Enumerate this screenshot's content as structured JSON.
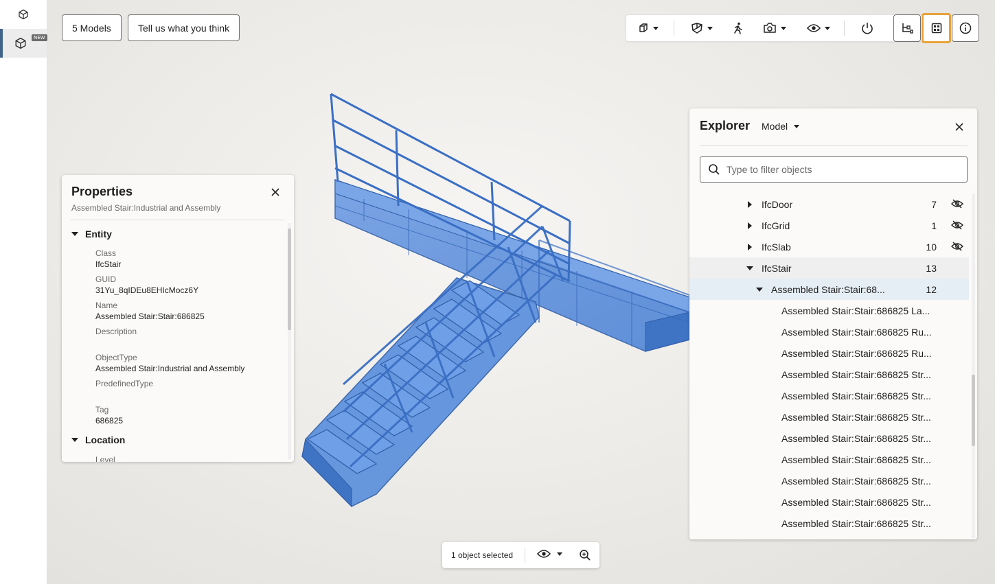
{
  "left_rail": {
    "items": [
      {
        "icon": "cube-icon",
        "active": false
      },
      {
        "icon": "cube-icon",
        "active": true,
        "badge": "NEW"
      }
    ]
  },
  "top_buttons": {
    "models_label": "5 Models",
    "feedback_label": "Tell us what you think"
  },
  "toolbar": {
    "icons": [
      "cube-view-icon",
      "section-box-icon",
      "walk-icon",
      "camera-icon",
      "eye-icon",
      "reset-icon",
      "tree-icon",
      "grid-icon",
      "info-icon"
    ],
    "active_button": "grid-icon",
    "active_color": "#e8a33a"
  },
  "properties": {
    "title": "Properties",
    "subtitle": "Assembled Stair:Industrial and Assembly",
    "sections": [
      {
        "title": "Entity",
        "fields": [
          {
            "label": "Class",
            "value": "IfcStair"
          },
          {
            "label": "GUID",
            "value": "31Yu_8qIDEu8EHIcMocz6Y"
          },
          {
            "label": "Name",
            "value": "Assembled Stair:Stair:686825"
          },
          {
            "label": "Description",
            "value": ""
          },
          {
            "label": "ObjectType",
            "value": "Assembled Stair:Industrial and Assembly"
          },
          {
            "label": "PredefinedType",
            "value": ""
          },
          {
            "label": "Tag",
            "value": "686825"
          }
        ]
      },
      {
        "title": "Location",
        "fields": [
          {
            "label": "Level",
            "value": ""
          }
        ]
      }
    ]
  },
  "explorer": {
    "title": "Explorer",
    "mode": "Model",
    "search_placeholder": "Type to filter objects",
    "rows": [
      {
        "label": "IfcDoor",
        "count": "7",
        "hidden": true,
        "expanded": false
      },
      {
        "label": "IfcGrid",
        "count": "1",
        "hidden": true,
        "expanded": false
      },
      {
        "label": "IfcSlab",
        "count": "10",
        "hidden": true,
        "expanded": false
      },
      {
        "label": "IfcStair",
        "count": "13",
        "hidden": false,
        "expanded": true
      },
      {
        "label": "Assembled Stair:Stair:68...",
        "count": "12",
        "hidden": false,
        "expanded": true,
        "selected": true
      },
      {
        "label": "Assembled Stair:Stair:686825 La..."
      },
      {
        "label": "Assembled Stair:Stair:686825 Ru..."
      },
      {
        "label": "Assembled Stair:Stair:686825 Ru..."
      },
      {
        "label": "Assembled Stair:Stair:686825 Str..."
      },
      {
        "label": "Assembled Stair:Stair:686825 Str..."
      },
      {
        "label": "Assembled Stair:Stair:686825 Str..."
      },
      {
        "label": "Assembled Stair:Stair:686825 Str..."
      },
      {
        "label": "Assembled Stair:Stair:686825 Str..."
      },
      {
        "label": "Assembled Stair:Stair:686825 Str..."
      },
      {
        "label": "Assembled Stair:Stair:686825 Str..."
      },
      {
        "label": "Assembled Stair:Stair:686825 Str..."
      }
    ]
  },
  "status_bar": {
    "text": "1 object selected"
  },
  "colors": {
    "model_fill": "#5b8fdc",
    "model_stroke": "#2f5ea8",
    "selected_row": "#e6eef5"
  }
}
